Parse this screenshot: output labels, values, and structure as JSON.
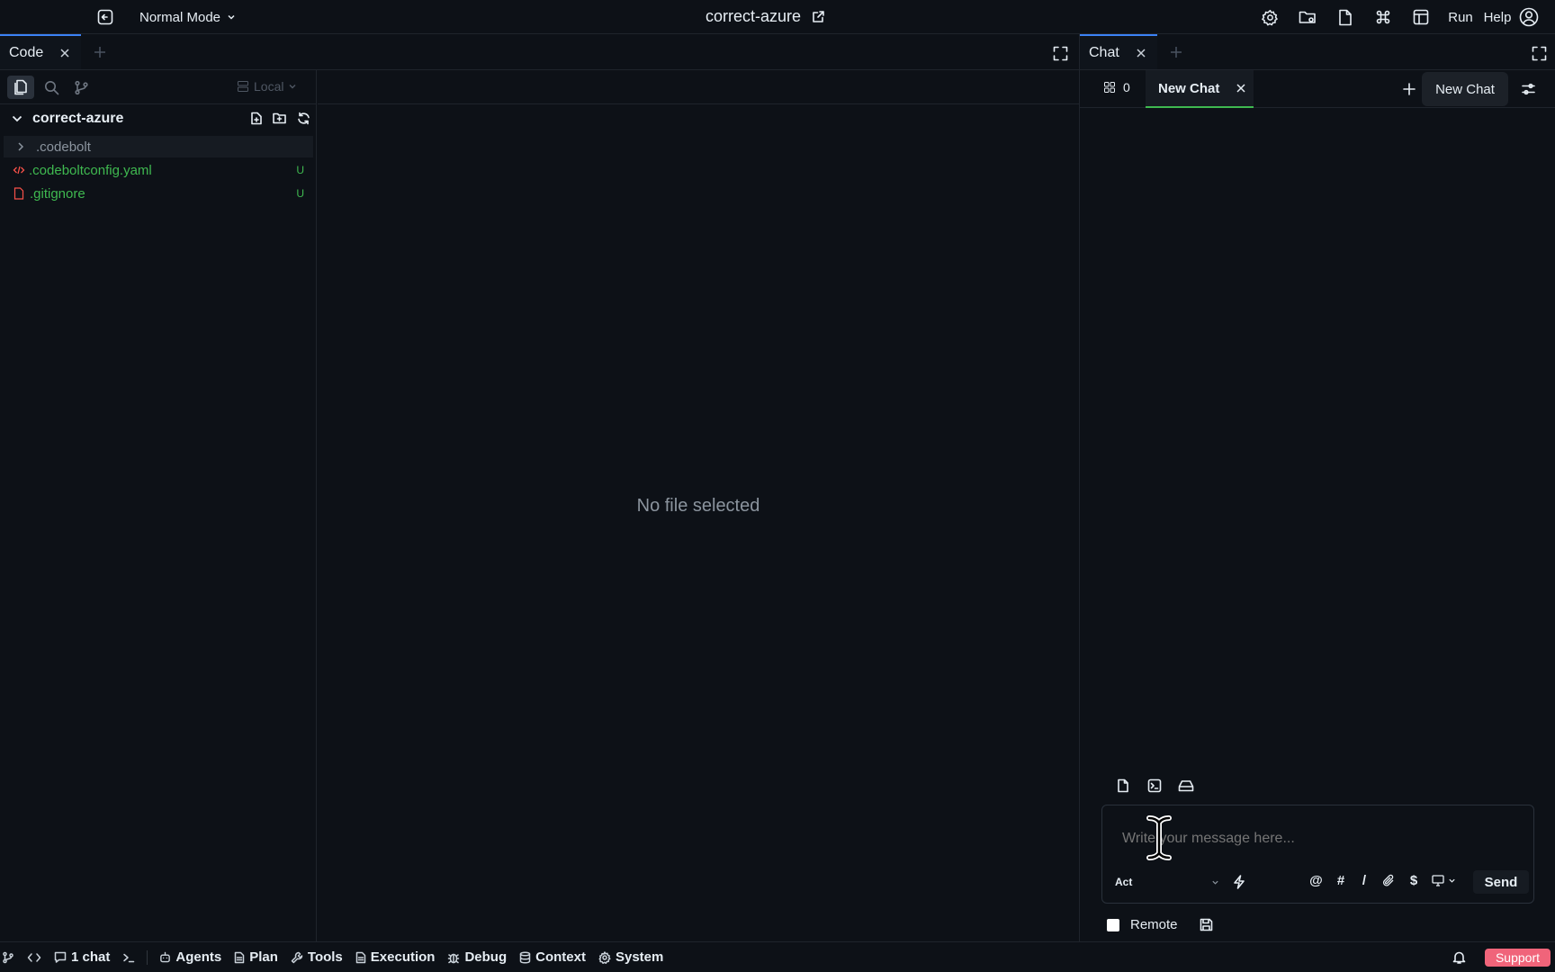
{
  "topbar": {
    "mode_label": "Normal Mode",
    "project_title": "correct-azure",
    "run_label": "Run",
    "help_label": "Help"
  },
  "left_panel": {
    "tab_label": "Code",
    "location_label": "Local"
  },
  "file_tree": {
    "root_name": "correct-azure",
    "items": [
      {
        "name": ".codebolt",
        "type": "folder",
        "badge": ""
      },
      {
        "name": ".codeboltconfig.yaml",
        "type": "yaml",
        "badge": "U"
      },
      {
        "name": ".gitignore",
        "type": "file",
        "badge": "U"
      }
    ]
  },
  "editor": {
    "empty_message": "No file selected"
  },
  "chat_panel": {
    "tab_label": "Chat",
    "agents_count": "0",
    "active_chat_label": "New Chat",
    "new_chat_tooltip": "New Chat",
    "input_placeholder": "Write your message here...",
    "mode_select": "Act",
    "mention_symbols": [
      "@",
      "#",
      "/",
      "$"
    ],
    "send_label": "Send",
    "remote_label": "Remote"
  },
  "statusbar": {
    "chat_count": "1 chat",
    "items": [
      "Agents",
      "Plan",
      "Tools",
      "Execution",
      "Debug",
      "Context",
      "System"
    ],
    "support_label": "Support"
  },
  "colors": {
    "background": "#0d1117",
    "accent_blue": "#3b82f6",
    "git_green": "#3fb950",
    "yaml_red": "#f85149",
    "support_pink": "#f0647a"
  }
}
